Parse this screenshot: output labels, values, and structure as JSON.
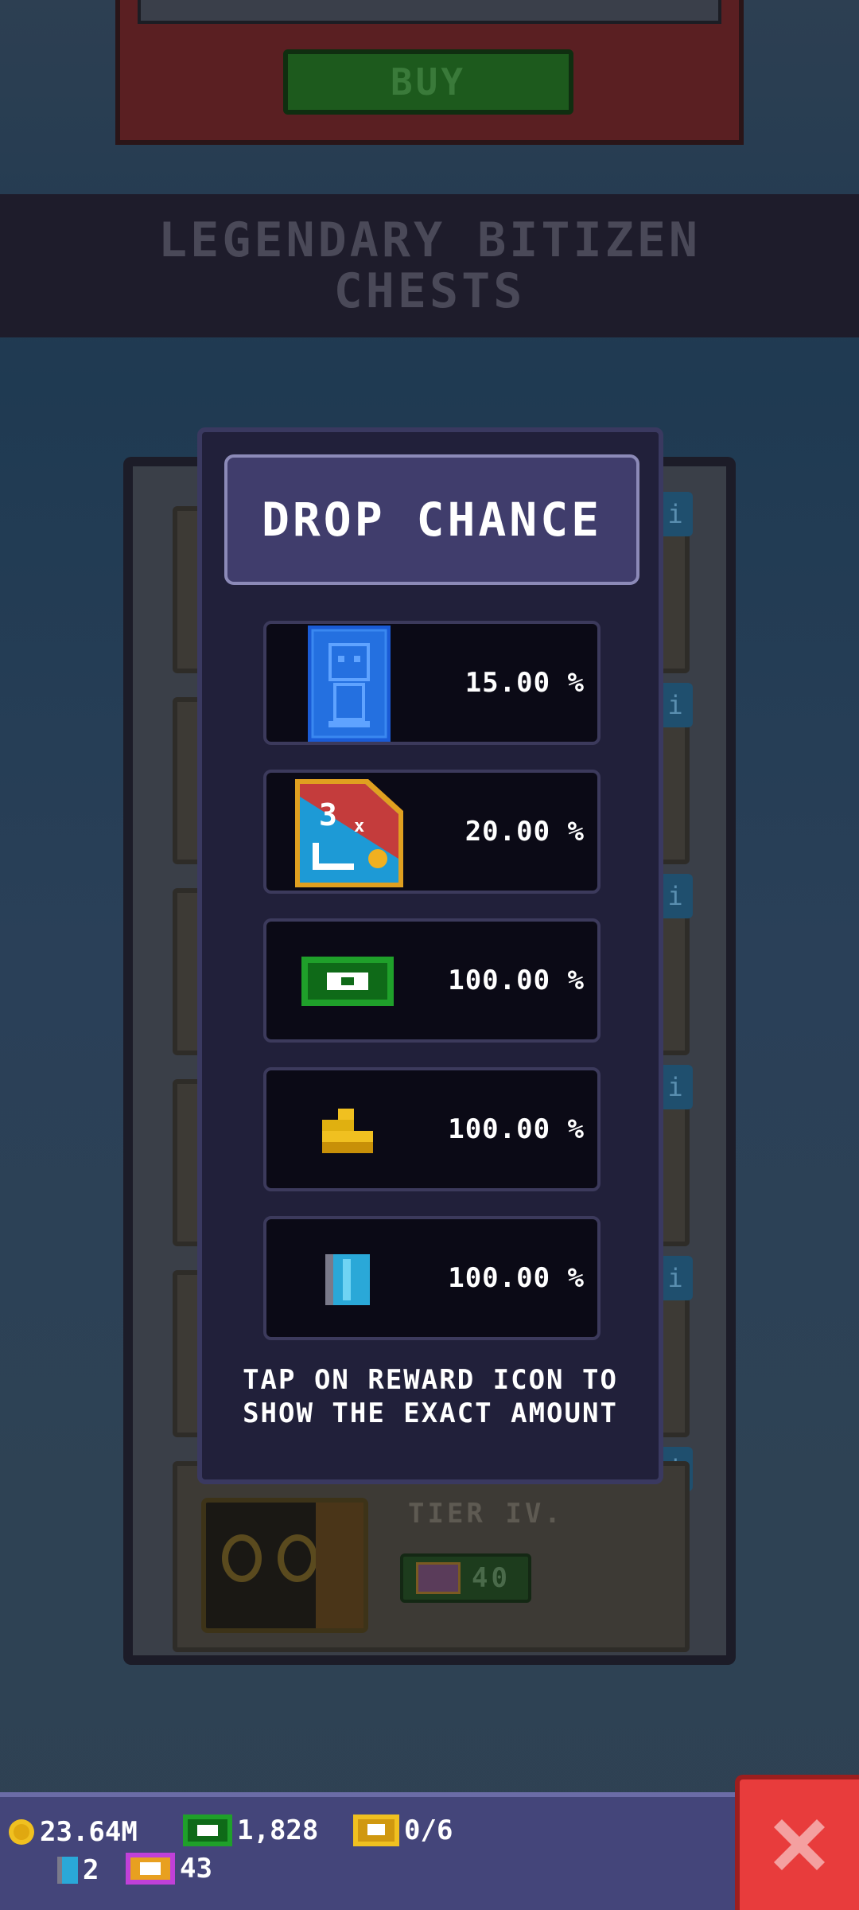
{
  "top_card": {
    "buy_label": "BUY"
  },
  "section": {
    "title": "LEGENDARY BITIZEN CHESTS"
  },
  "chest_list": {
    "info_glyph": "i",
    "tier_label": "TIER IV.",
    "tier_price": "40"
  },
  "modal": {
    "title": "DROP CHANCE",
    "rows": [
      {
        "icon": "blueprint-icon",
        "value": "15.00 %"
      },
      {
        "icon": "multiplier-card-icon",
        "value": "20.00 %"
      },
      {
        "icon": "bux-icon",
        "value": "100.00 %"
      },
      {
        "icon": "coin-stack-icon",
        "value": "100.00 %"
      },
      {
        "icon": "key-icon",
        "value": "100.00 %"
      }
    ],
    "hint": "TAP ON REWARD ICON TO SHOW THE EXACT AMOUNT"
  },
  "resources": {
    "coins": "23.64M",
    "bux": "1,828",
    "tickets": "0/6",
    "keys": "2",
    "chest_tickets": "43"
  },
  "colors": {
    "accent_red": "#e83c3c",
    "modal_bg": "#21203a",
    "bar_bg": "#44457a"
  }
}
